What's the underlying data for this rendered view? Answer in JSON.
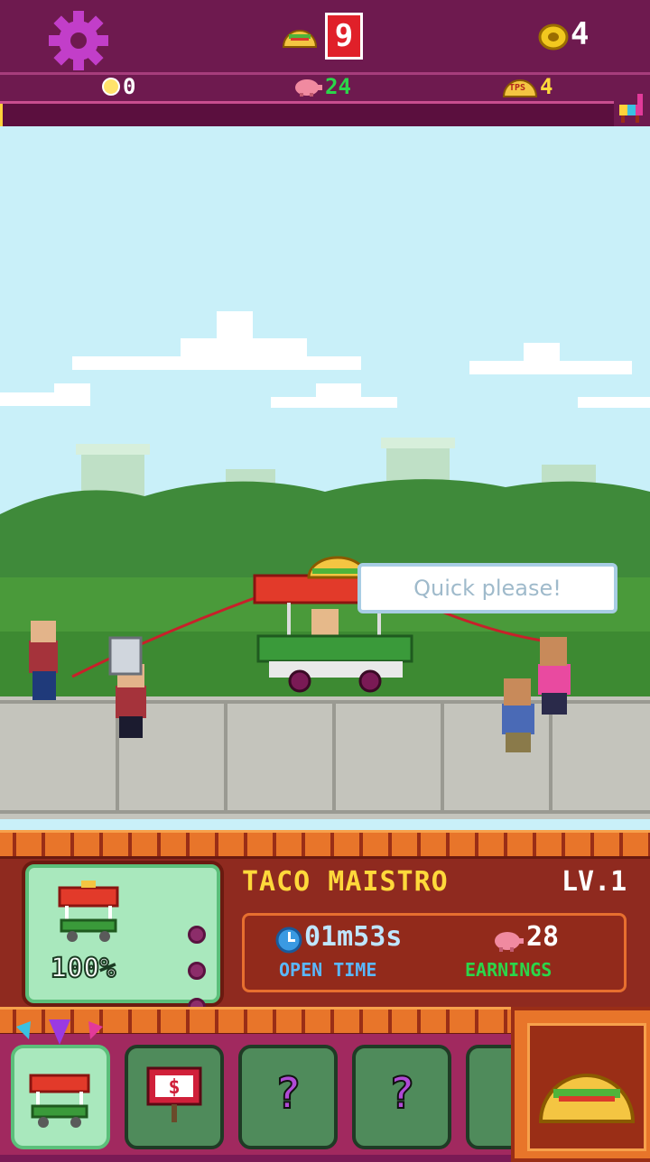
{
  "hud": {
    "taco_count": "9",
    "coins": "4",
    "gems": "0",
    "piggy": "24",
    "tps_label": "TPS",
    "tps": "4",
    "xp_progress": 0.004
  },
  "scene": {
    "speech": "Quick please!"
  },
  "stall": {
    "name": "TACO MAISTRO",
    "level": "LV.1",
    "percent": "100%",
    "open_time": "01m53s",
    "open_time_label": "OPEN TIME",
    "earnings": "28",
    "earnings_label": "EARNINGS"
  },
  "nav": {
    "locked_mark": "?"
  },
  "colors": {
    "hud_bg": "#6e1a4f",
    "accent_yellow": "#ffd93b",
    "green_text": "#2bd64a",
    "sky": "#c9f0f9",
    "grass": "#4a9a3a"
  }
}
